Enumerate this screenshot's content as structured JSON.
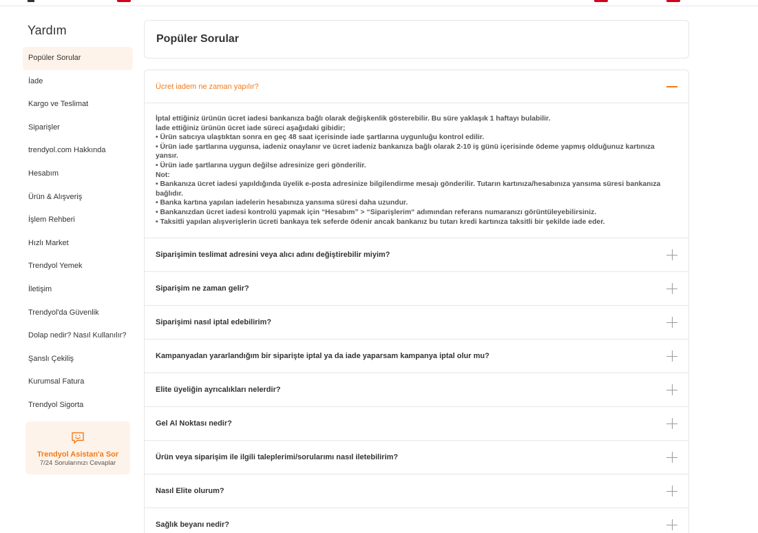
{
  "sidebar": {
    "title": "Yardım",
    "items": [
      {
        "label": "Popüler Sorular",
        "active": true
      },
      {
        "label": "İade",
        "active": false
      },
      {
        "label": "Kargo ve Teslimat",
        "active": false
      },
      {
        "label": "Siparişler",
        "active": false
      },
      {
        "label": "trendyol.com Hakkında",
        "active": false
      },
      {
        "label": "Hesabım",
        "active": false
      },
      {
        "label": "Ürün & Alışveriş",
        "active": false
      },
      {
        "label": "İşlem Rehberi",
        "active": false
      },
      {
        "label": "Hızlı Market",
        "active": false
      },
      {
        "label": "Trendyol Yemek",
        "active": false
      },
      {
        "label": "İletişim",
        "active": false
      },
      {
        "label": "Trendyol'da Güvenlik",
        "active": false
      },
      {
        "label": "Dolap nedir? Nasıl Kullanılır?",
        "active": false
      },
      {
        "label": "Şanslı Çekiliş",
        "active": false
      },
      {
        "label": "Kurumsal Fatura",
        "active": false
      },
      {
        "label": "Trendyol Sigorta",
        "active": false
      }
    ],
    "assistant": {
      "title": "Trendyol Asistan'a Sor",
      "subtitle": "7/24 Sorularınızı Cevaplar",
      "icon": "chat-smile-icon"
    }
  },
  "main": {
    "title": "Popüler Sorular",
    "faqs": [
      {
        "question": "Ücret iadem ne zaman yapılır?",
        "open": true,
        "answer_lines": [
          "İptal ettiğiniz ürünün ücret iadesi bankanıza bağlı olarak değişkenlik gösterebilir. Bu süre yaklaşık 1 haftayı bulabilir.",
          "İade ettiğiniz ürünün ücret iade süreci aşağıdaki gibidir;",
          "• Ürün satıcıya ulaştıktan sonra en geç 48 saat içerisinde iade şartlarına uygunluğu kontrol edilir.",
          "• Ürün iade şartlarına uygunsa, iadeniz onaylanır ve ücret iadeniz bankanıza bağlı olarak 2-10 iş günü içerisinde ödeme yapmış olduğunuz kartınıza yansır.",
          "• Ürün iade şartlarına uygun değilse adresinize geri gönderilir.",
          "Not:",
          "• Bankanıza ücret iadesi yapıldığında üyelik e-posta adresinize bilgilendirme mesajı gönderilir. Tutarın kartınıza/hesabınıza yansıma süresi bankanıza bağlıdır.",
          "• Banka kartına yapılan iadelerin hesabınıza yansıma süresi daha uzundur.",
          "• Bankanızdan ücret iadesi kontrolü yapmak için “Hesabım” > “Siparişlerim“ adımından referans numaranızı görüntüleyebilirsiniz.",
          "• Taksitli yapılan alışverişlerin ücreti bankaya tek seferde ödenir ancak bankanız bu tutarı kredi kartınıza taksitli bir şekilde iade eder."
        ]
      },
      {
        "question": "Siparişimin teslimat adresini veya alıcı adını değiştirebilir miyim?",
        "open": false
      },
      {
        "question": "Siparişim ne zaman gelir?",
        "open": false
      },
      {
        "question": "Siparişimi nasıl iptal edebilirim?",
        "open": false
      },
      {
        "question": "Kampanyadan yararlandığım bir siparişte iptal ya da iade yaparsam kampanya iptal olur mu?",
        "open": false
      },
      {
        "question": "Elite üyeliğin ayrıcalıkları nelerdir?",
        "open": false
      },
      {
        "question": "Gel Al Noktası nedir?",
        "open": false
      },
      {
        "question": "Ürün veya siparişim ile ilgili taleplerimi/sorularımı nasıl iletebilirim?",
        "open": false
      },
      {
        "question": "Nasıl Elite olurum?",
        "open": false
      },
      {
        "question": "Sağlık beyanı nedir?",
        "open": false
      }
    ]
  },
  "colors": {
    "accent": "#f27a1a",
    "accent_light": "#fef3ea",
    "border": "#e6e6e6",
    "text": "#333333"
  }
}
